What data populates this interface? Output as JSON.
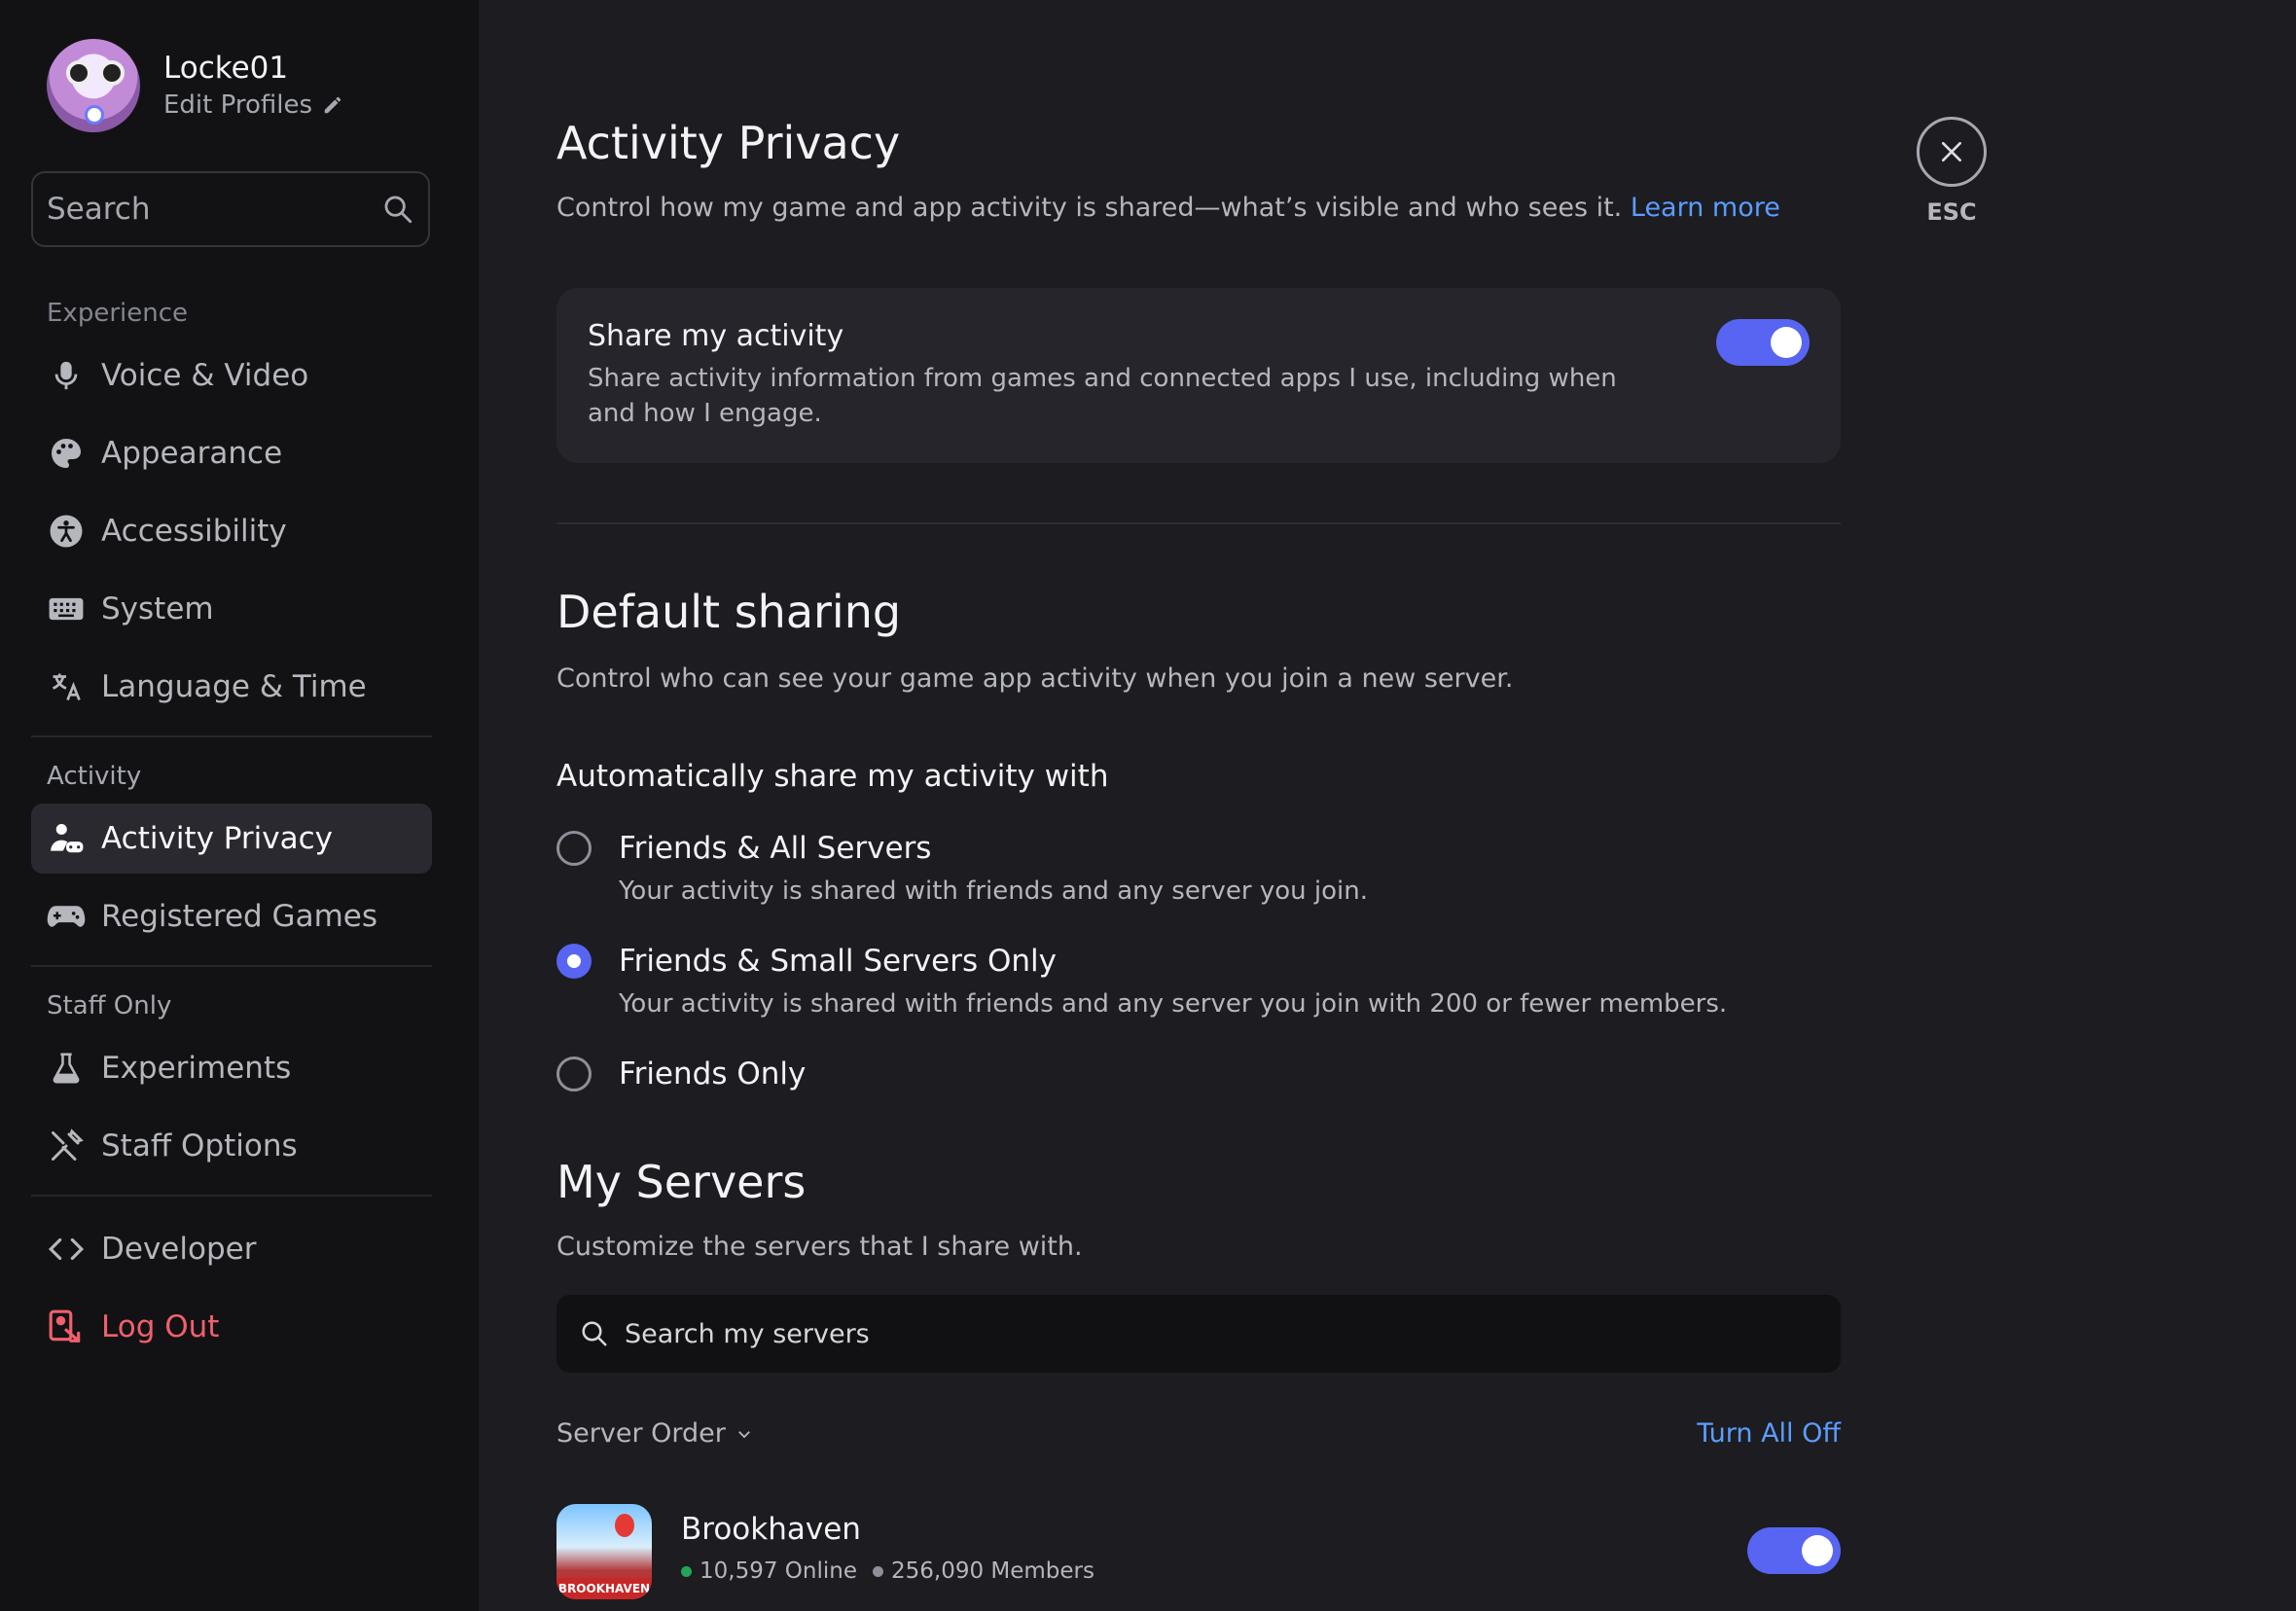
{
  "sidebar": {
    "username": "Locke01",
    "edit_profiles": "Edit Profiles",
    "search_placeholder": "Search",
    "sections": {
      "experience": "Experience",
      "activity": "Activity",
      "staff": "Staff Only"
    },
    "items": {
      "voice_video": "Voice & Video",
      "appearance": "Appearance",
      "accessibility": "Accessibility",
      "system": "System",
      "language_time": "Language & Time",
      "activity_privacy": "Activity Privacy",
      "registered_games": "Registered Games",
      "experiments": "Experiments",
      "staff_options": "Staff Options",
      "developer": "Developer",
      "log_out": "Log Out"
    }
  },
  "main": {
    "title": "Activity Privacy",
    "description": "Control how my game and app activity is shared—what’s visible and who sees it.",
    "learn_more": "Learn more",
    "close_label": "ESC",
    "share_card": {
      "title": "Share my activity",
      "description": "Share activity information from games and connected apps I use, including when and how I engage.",
      "enabled": true
    },
    "default_sharing": {
      "title": "Default sharing",
      "description": "Control who can see your game app activity when you join a new server.",
      "subheading": "Automatically share my activity with",
      "options": [
        {
          "label": "Friends & All Servers",
          "sub": "Your activity is shared with friends and any server you join.",
          "selected": false
        },
        {
          "label": "Friends & Small Servers Only",
          "sub": "Your activity is shared with friends and any server you join with 200 or fewer members.",
          "selected": true
        },
        {
          "label": "Friends Only",
          "sub": "",
          "selected": false
        }
      ]
    },
    "my_servers": {
      "title": "My Servers",
      "description": "Customize the servers that I share with.",
      "search_placeholder": "Search my servers",
      "order_label": "Server Order",
      "turn_all_off": "Turn All Off",
      "servers": [
        {
          "name": "Brookhaven",
          "online": "10,597 Online",
          "members": "256,090 Members",
          "icon_text": "BROOKHAVEN",
          "enabled": true
        }
      ]
    }
  },
  "colors": {
    "accent": "#5865f2",
    "link": "#5b9dff",
    "danger": "#f0606d",
    "online": "#23a55a"
  }
}
